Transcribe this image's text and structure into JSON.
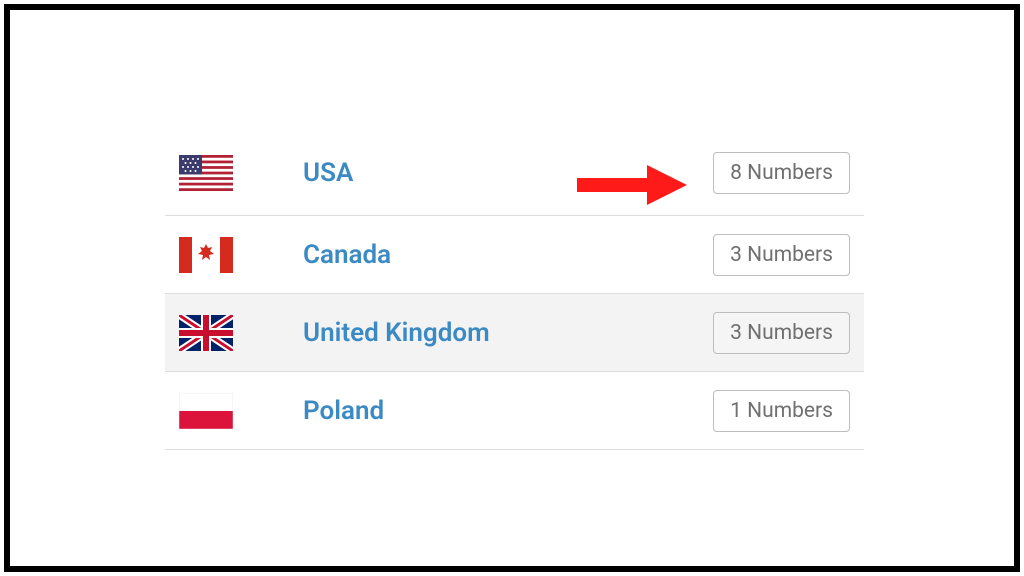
{
  "countries": [
    {
      "name": "USA",
      "count_label": "8 Numbers",
      "highlight": false
    },
    {
      "name": "Canada",
      "count_label": "3 Numbers",
      "highlight": false
    },
    {
      "name": "United Kingdom",
      "count_label": "3 Numbers",
      "highlight": true
    },
    {
      "name": "Poland",
      "count_label": "1 Numbers",
      "highlight": false
    }
  ],
  "arrow_color": "#ff1a1a"
}
